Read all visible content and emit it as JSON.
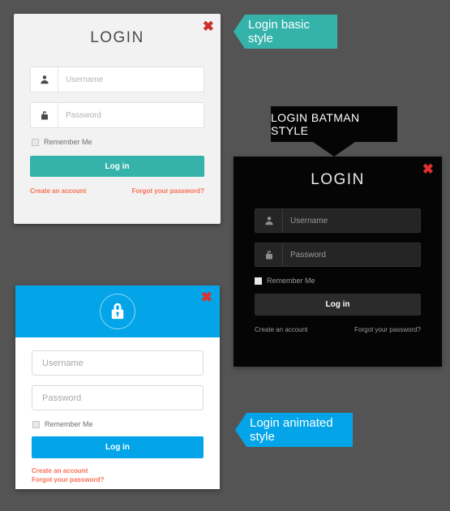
{
  "background_color": "#545454",
  "cards": {
    "basic": {
      "title": "LOGIN",
      "close_label": "✖",
      "username_placeholder": "Username",
      "password_placeholder": "Password",
      "username_value": "",
      "password_value": "",
      "remember_label": "Remember Me",
      "login_button": "Log in",
      "create_account_link": "Create an account",
      "forgot_password_link": "Forgot your password?",
      "accent_color": "#35b3ab",
      "link_color": "#fb6f53",
      "surface_color": "#f2f2f2",
      "user_icon": "user-icon",
      "lock_icon": "lock-icon"
    },
    "batman": {
      "title": "LOGIN",
      "close_label": "✖",
      "username_placeholder": "Username",
      "password_placeholder": "Password",
      "username_value": "",
      "password_value": "",
      "remember_label": "Remember Me",
      "login_button": "Log in",
      "create_account_link": "Create an account",
      "forgot_password_link": "Forgot your password?",
      "accent_color": "#2b2b2b",
      "link_color": "#9b9b9b",
      "surface_color": "#050505",
      "user_icon": "user-icon",
      "lock_icon": "lock-icon"
    },
    "animated": {
      "title": "",
      "close_label": "✖",
      "header_icon": "lock-circle-icon",
      "username_placeholder": "Username",
      "password_placeholder": "Password",
      "username_value": "",
      "password_value": "",
      "remember_label": "Remember Me",
      "login_button": "Log in",
      "create_account_link": "Create an account",
      "forgot_password_link": "Forgot your password?",
      "accent_color": "#03a5e8",
      "link_color": "#fb6f53",
      "surface_color": "#ffffff"
    }
  },
  "labels": {
    "basic_ribbon": "Login basic style",
    "batman_plaque": "LOGIN BATMAN STYLE",
    "animated_ribbon": "Login animated style"
  }
}
